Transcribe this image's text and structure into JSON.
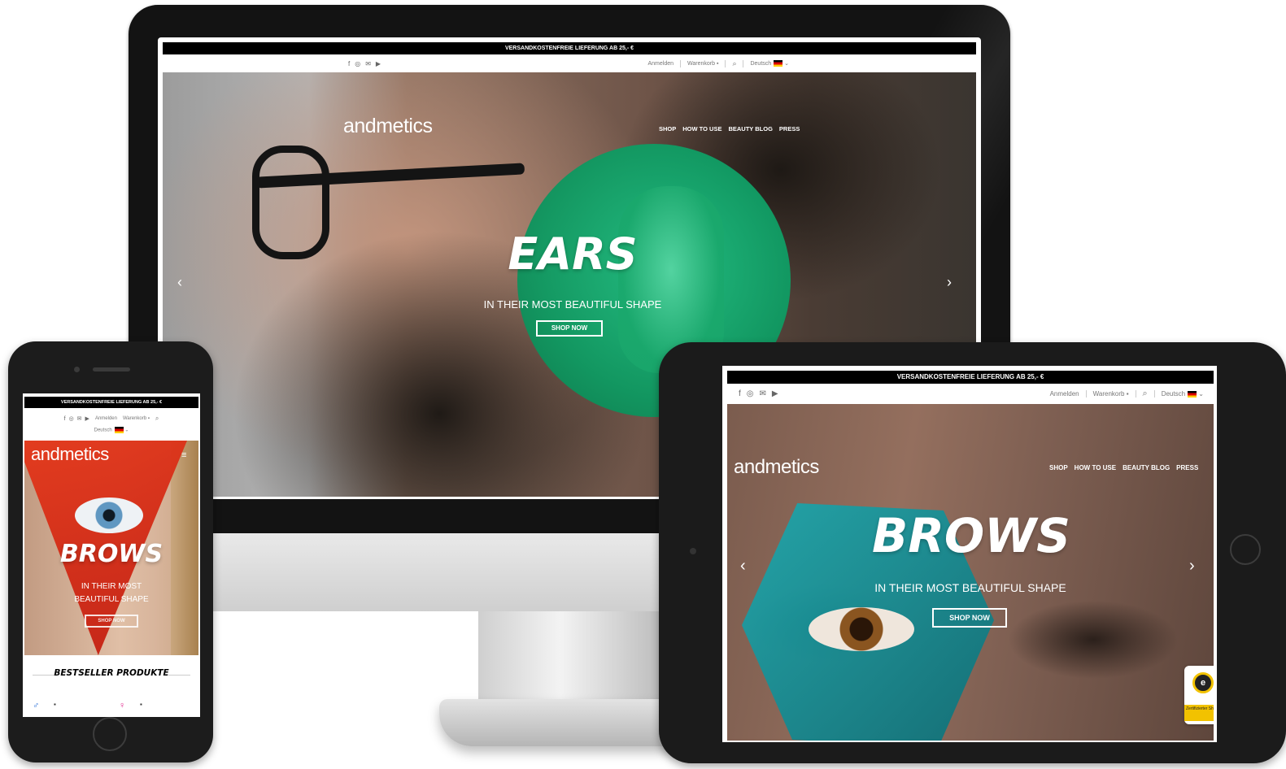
{
  "promo_text": "VERSANDKOSTENFREIE LIEFERUNG AB 25,- €",
  "topbar": {
    "login": "Anmelden",
    "cart": "Warenkorb",
    "language": "Deutsch"
  },
  "brand": "andmetics",
  "nav": [
    "SHOP",
    "HOW TO USE",
    "BEAUTY BLOG",
    "PRESS"
  ],
  "desktop": {
    "headline": "EARS",
    "subheadline": "IN THEIR MOST BEAUTIFUL SHAPE",
    "cta": "SHOP NOW"
  },
  "tablet": {
    "headline": "BROWS",
    "subheadline": "IN THEIR MOST BEAUTIFUL SHAPE",
    "cta": "SHOP NOW",
    "badge_label": "Zertifizierter Shop"
  },
  "phone": {
    "headline": "BROWS",
    "subheadline_line1": "IN THEIR MOST",
    "subheadline_line2": "BEAUTIFUL SHAPE",
    "cta": "SHOP NOW",
    "section_title": "BESTSELLER PRODUKTE"
  },
  "icons": {
    "social": [
      "facebook-icon",
      "instagram-icon",
      "email-icon",
      "youtube-icon"
    ],
    "search": "search-icon",
    "cart": "bag-icon",
    "prev": "chevron-left-icon",
    "next": "chevron-right-icon",
    "menu": "hamburger-icon",
    "flag": "german-flag-icon",
    "male": "male-symbol-icon",
    "female": "female-symbol-icon"
  },
  "colors": {
    "promo_bg": "#000000",
    "ears_accent": "#14a86a",
    "brows_tablet_accent": "#1a9aa0",
    "brows_phone_accent": "#d42a14",
    "male_symbol": "#2a6fd6",
    "female_symbol": "#e0278c",
    "badge_yellow": "#f2c200"
  }
}
